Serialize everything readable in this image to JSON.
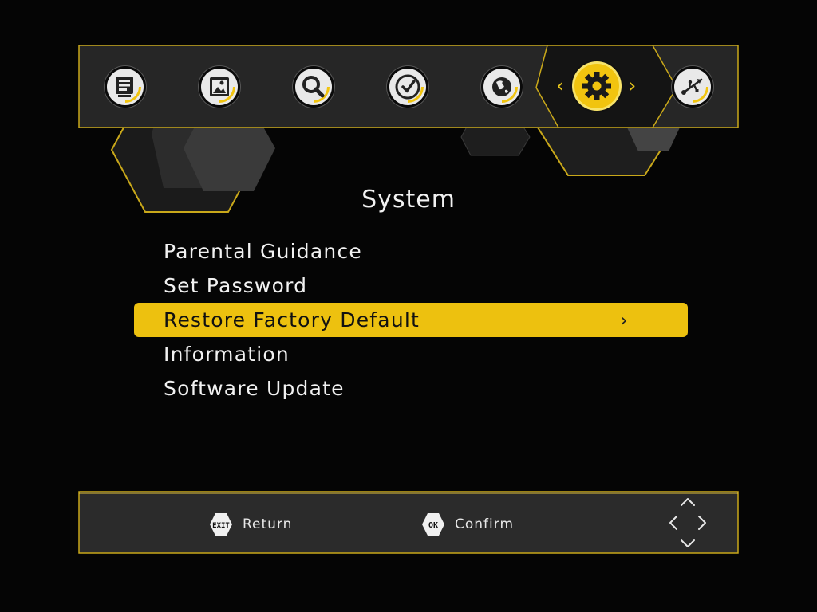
{
  "header": {
    "title": "System"
  },
  "toolbar": {
    "icons": [
      {
        "name": "list-icon"
      },
      {
        "name": "picture-icon"
      },
      {
        "name": "search-icon"
      },
      {
        "name": "clock-icon"
      },
      {
        "name": "globe-icon"
      },
      {
        "name": "gear-icon",
        "active": true
      },
      {
        "name": "usb-icon"
      }
    ],
    "active_arrow_left": "‹",
    "active_arrow_right": "›"
  },
  "menu": {
    "items": [
      {
        "label": "Parental Guidance"
      },
      {
        "label": "Set Password"
      },
      {
        "label": "Restore Factory Default",
        "selected": true,
        "chevron": "›"
      },
      {
        "label": "Information"
      },
      {
        "label": "Software Update"
      }
    ]
  },
  "footer": {
    "exit_badge": "EXIT",
    "return_label": "Return",
    "ok_badge": "OK",
    "confirm_label": "Confirm"
  },
  "colors": {
    "accent": "#edc10f",
    "background": "#050505",
    "panel": "#2b2b2b",
    "border": "#c9a81a",
    "text": "#f2f2f2"
  }
}
